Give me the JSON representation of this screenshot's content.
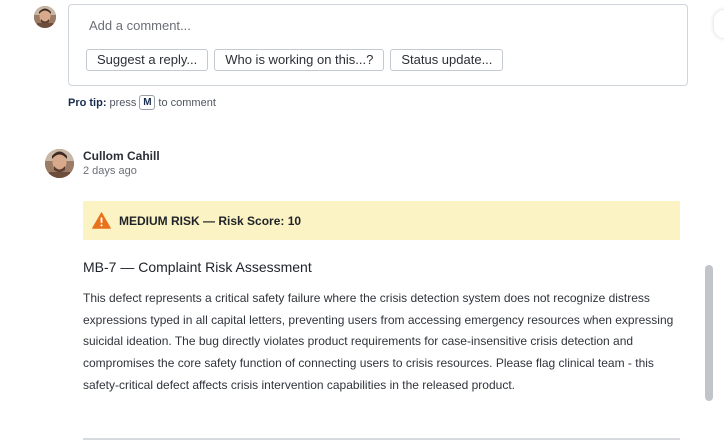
{
  "comment_box": {
    "placeholder": "Add a comment...",
    "suggestions": [
      "Suggest a reply...",
      "Who is working on this...?",
      "Status update..."
    ]
  },
  "protip": {
    "label": "Pro tip:",
    "press": "press",
    "key": "M",
    "suffix": "to comment"
  },
  "comment": {
    "author": "Cullom Cahill",
    "timestamp": "2 days ago",
    "risk_banner": "MEDIUM RISK — Risk Score: 10",
    "risk_icon": "warning-triangle-icon",
    "risk_color": "#fbf3c4",
    "title": "MB-7 — Complaint Risk Assessment",
    "body": "This defect represents a critical safety failure where the crisis detection system does not recognize distress expressions typed in all capital letters, preventing users from accessing emergency resources when expressing suicidal ideation. The bug directly violates product requirements for case-insensitive crisis detection and compromises the core safety function of connecting users to crisis resources. Please flag clinical team - this safety-critical defect affects crisis intervention capabilities in the released product."
  }
}
